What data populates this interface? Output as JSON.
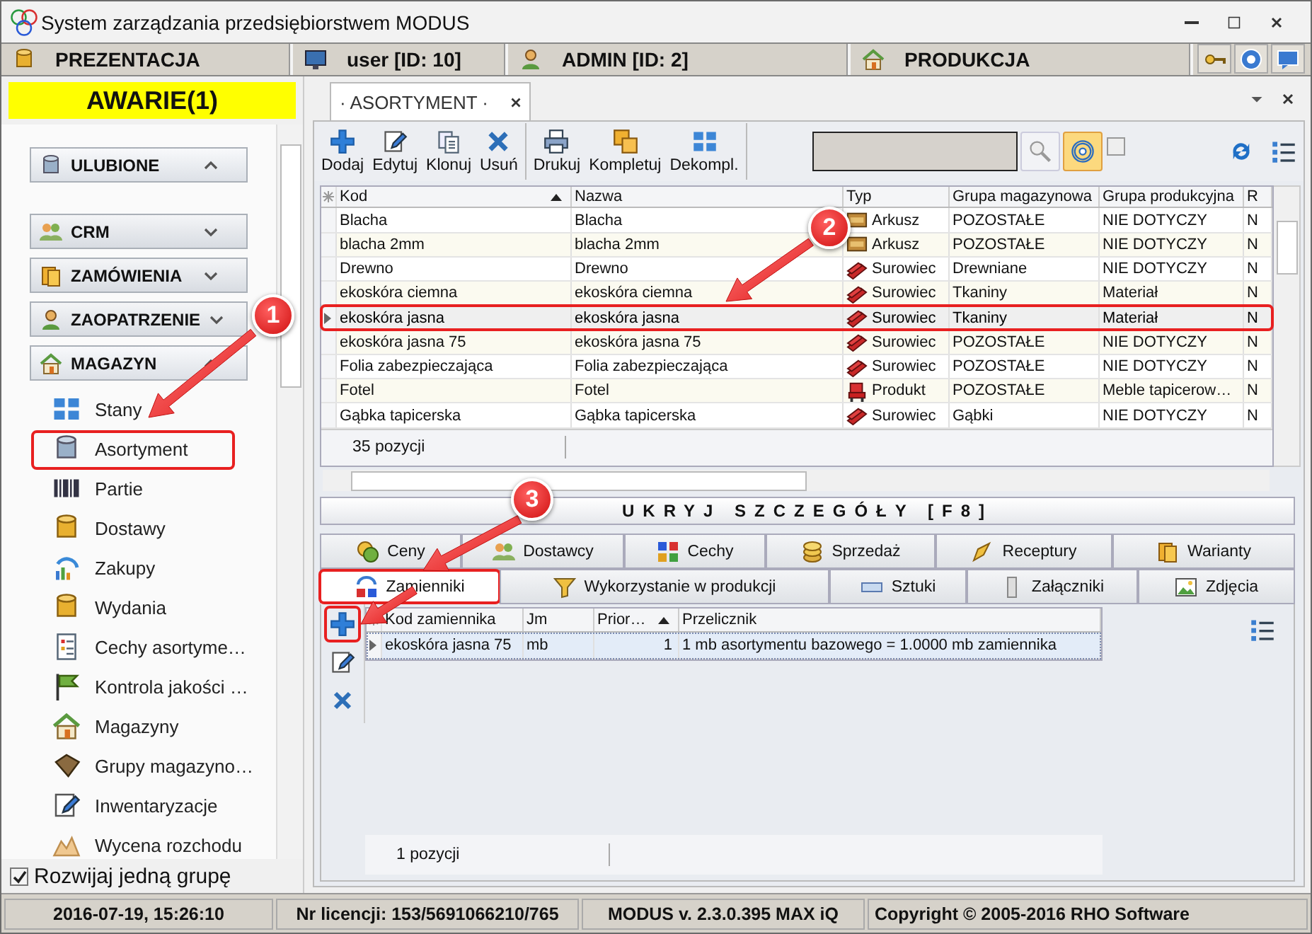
{
  "window": {
    "title": "System zarządzania przedsiębiorstwem MODUS"
  },
  "info_bar": [
    {
      "label": "PREZENTACJA"
    },
    {
      "label": "user [ID: 10]"
    },
    {
      "label": "ADMIN [ID: 2]"
    },
    {
      "label": "PRODUKCJA"
    }
  ],
  "sidebar": {
    "alert": "AWARIE(1)",
    "groups": [
      {
        "label": "ULUBIONE",
        "expanded": true
      },
      {
        "label": "CRM",
        "expanded": false
      },
      {
        "label": "ZAMÓWIENIA",
        "expanded": false
      },
      {
        "label": "ZAOPATRZENIE",
        "expanded": false
      },
      {
        "label": "MAGAZYN",
        "expanded": true,
        "items": [
          {
            "label": "Stany"
          },
          {
            "label": "Asortyment"
          },
          {
            "label": "Partie"
          },
          {
            "label": "Dostawy"
          },
          {
            "label": "Zakupy"
          },
          {
            "label": "Wydania"
          },
          {
            "label": "Cechy asortyme…"
          },
          {
            "label": "Kontrola jakości …"
          },
          {
            "label": "Magazyny"
          },
          {
            "label": "Grupy magazyno…"
          },
          {
            "label": "Inwentaryzacje"
          },
          {
            "label": "Wycena rozchodu"
          }
        ]
      }
    ],
    "option": {
      "label": "Rozwijaj jedną grupę",
      "checked": true
    }
  },
  "document_tab": {
    "label": "· ASORTYMENT ·"
  },
  "toolbar": {
    "groups": [
      [
        "Dodaj",
        "Edytuj",
        "Klonuj",
        "Usuń"
      ],
      [
        "Drukuj",
        "Kompletuj",
        "Dekompl."
      ]
    ],
    "filter_toggle": {
      "on": true
    },
    "checkbox": {
      "checked": false
    }
  },
  "grid": {
    "columns": [
      {
        "label": "Kod",
        "sorted": true
      },
      {
        "label": "Nazwa",
        "sorted": false
      },
      {
        "label": "Typ",
        "sorted": false
      },
      {
        "label": "Grupa magazynowa",
        "sorted": false
      },
      {
        "label": "Grupa produkcyjna",
        "sorted": false
      },
      {
        "label": "R",
        "sorted": false
      }
    ],
    "rows": [
      {
        "cells": [
          "Blacha",
          "Blacha",
          "Arkusz",
          "POZOSTAŁE",
          "NIE DOTYCZY",
          "N"
        ],
        "kind": "sheet",
        "selected": false
      },
      {
        "cells": [
          "blacha 2mm",
          "blacha 2mm",
          "Arkusz",
          "POZOSTAŁE",
          "NIE DOTYCZY",
          "N"
        ],
        "kind": "sheet",
        "selected": false
      },
      {
        "cells": [
          "Drewno",
          "Drewno",
          "Surowiec",
          "Drewniane",
          "NIE DOTYCZY",
          "N"
        ],
        "kind": "raw",
        "selected": false
      },
      {
        "cells": [
          "ekoskóra ciemna",
          "ekoskóra ciemna",
          "Surowiec",
          "Tkaniny",
          "Materiał",
          "N"
        ],
        "kind": "raw",
        "selected": false
      },
      {
        "cells": [
          "ekoskóra jasna",
          "ekoskóra jasna",
          "Surowiec",
          "Tkaniny",
          "Materiał",
          "N"
        ],
        "kind": "raw",
        "selected": true
      },
      {
        "cells": [
          "ekoskóra jasna 75",
          "ekoskóra jasna 75",
          "Surowiec",
          "POZOSTAŁE",
          "NIE DOTYCZY",
          "N"
        ],
        "kind": "raw",
        "selected": false
      },
      {
        "cells": [
          "Folia zabezpieczająca",
          "Folia zabezpieczająca",
          "Surowiec",
          "POZOSTAŁE",
          "NIE DOTYCZY",
          "N"
        ],
        "kind": "raw",
        "selected": false
      },
      {
        "cells": [
          "Fotel",
          "Fotel",
          "Produkt",
          "POZOSTAŁE",
          "Meble tapicerow…",
          "N"
        ],
        "kind": "product",
        "selected": false
      },
      {
        "cells": [
          "Gąbka tapicerska",
          "Gąbka tapicerska",
          "Surowiec",
          "Gąbki",
          "NIE DOTYCZY",
          "N"
        ],
        "kind": "raw",
        "selected": false
      }
    ],
    "footer": "35 pozycji"
  },
  "details": {
    "toggle": "UKRYJ SZCZEGÓŁY [F8]",
    "tab_rows": [
      [
        {
          "label": "Ceny",
          "selected": false
        },
        {
          "label": "Dostawcy",
          "selected": false
        },
        {
          "label": "Cechy",
          "selected": false
        },
        {
          "label": "Sprzedaż",
          "selected": false
        },
        {
          "label": "Receptury",
          "selected": false
        },
        {
          "label": "Warianty",
          "selected": false
        }
      ],
      [
        {
          "label": "Zamienniki",
          "selected": true
        },
        {
          "label": "Wykorzystanie w produkcji",
          "selected": false
        },
        {
          "label": "Sztuki",
          "selected": false
        },
        {
          "label": "Załączniki",
          "selected": false
        },
        {
          "label": "Zdjęcia",
          "selected": false
        }
      ]
    ],
    "grid": {
      "columns": [
        {
          "label": "Kod zamiennika",
          "sorted": false
        },
        {
          "label": "Jm",
          "sorted": false
        },
        {
          "label": "Prior…",
          "sorted": true
        },
        {
          "label": "Przelicznik",
          "sorted": false
        }
      ],
      "rows": [
        {
          "cells": [
            "ekoskóra jasna 75",
            "mb",
            "1",
            "1 mb asortymentu bazowego = 1.0000 mb zamiennika"
          ],
          "selected": true
        }
      ],
      "footer": "1 pozycji"
    }
  },
  "status_bar": [
    "2016-07-19, 15:26:10",
    "Nr licencji:  153/5691066210/765",
    "MODUS v. 2.3.0.395 MAX iQ",
    "Copyright © 2005-2016 RHO Software"
  ],
  "callouts": [
    {
      "label": "1"
    },
    {
      "label": "2"
    },
    {
      "label": "3"
    }
  ]
}
